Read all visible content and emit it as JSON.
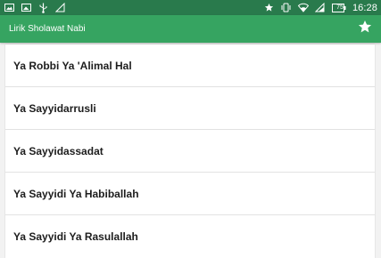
{
  "status_bar": {
    "time": "16:28",
    "battery_level": "75",
    "left_icons": [
      "image-icon",
      "photo-icon",
      "usb-icon",
      "debug-icon"
    ],
    "right_icons": [
      "star-icon",
      "vibrate-icon",
      "wifi-icon",
      "signal-icon",
      "battery-icon"
    ]
  },
  "app_bar": {
    "title": "Lirik Sholawat Nabi",
    "favorite_icon": "star-icon"
  },
  "list": {
    "items": [
      {
        "label": "Ya Robbi Ya 'Alimal Hal"
      },
      {
        "label": "Ya Sayyidarrusli"
      },
      {
        "label": "Ya Sayyidassadat"
      },
      {
        "label": "Ya Sayyidi Ya Habiballah"
      },
      {
        "label": "Ya Sayyidi Ya Rasulallah"
      }
    ]
  },
  "colors": {
    "status_bar": "#297a4c",
    "app_bar": "#36a461",
    "list_background": "#ffffff",
    "page_background": "#f2f2f2",
    "item_text": "#1d1d1d"
  }
}
